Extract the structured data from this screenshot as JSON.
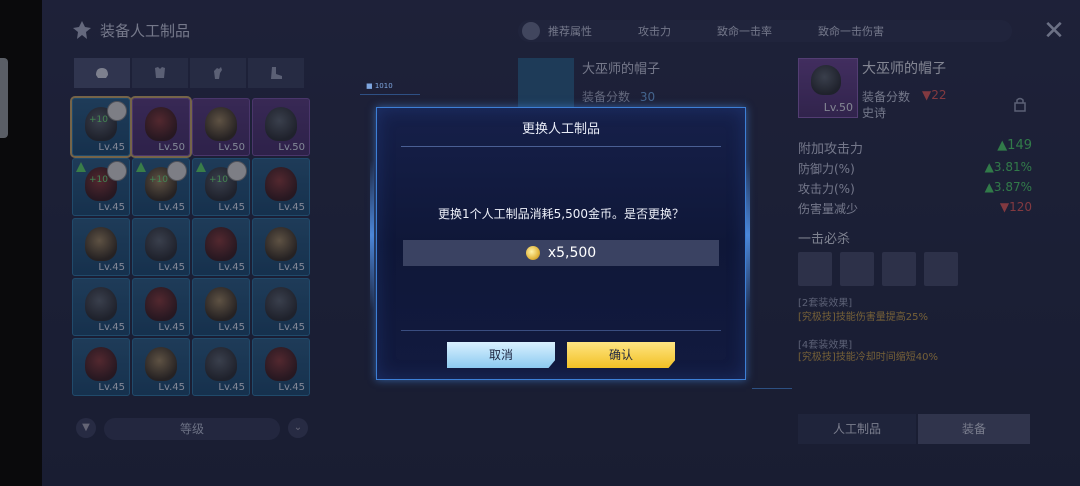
{
  "header": {
    "title": "装备人工制品"
  },
  "grid": {
    "items": [
      {
        "lv": "Lv.45",
        "plus": "+10",
        "variant": "blue",
        "selected": true,
        "avatar": true
      },
      {
        "lv": "Lv.50",
        "plus": "",
        "variant": "purple",
        "selected": true,
        "avatar": false
      },
      {
        "lv": "Lv.50",
        "plus": "",
        "variant": "purple"
      },
      {
        "lv": "Lv.50",
        "plus": "",
        "variant": "purple"
      },
      {
        "lv": "Lv.45",
        "plus": "+10",
        "variant": "blue",
        "arrow": true,
        "avatar": true
      },
      {
        "lv": "Lv.45",
        "plus": "+10",
        "variant": "blue",
        "arrow": true,
        "avatar": true
      },
      {
        "lv": "Lv.45",
        "plus": "+10",
        "variant": "blue",
        "arrow": true,
        "avatar": true
      },
      {
        "lv": "Lv.45",
        "plus": "",
        "variant": "blue"
      },
      {
        "lv": "Lv.45",
        "plus": "",
        "variant": "blue"
      },
      {
        "lv": "Lv.45",
        "plus": "",
        "variant": "blue"
      },
      {
        "lv": "Lv.45",
        "plus": "",
        "variant": "blue"
      },
      {
        "lv": "Lv.45",
        "plus": "",
        "variant": "blue"
      },
      {
        "lv": "Lv.45",
        "plus": "",
        "variant": "blue"
      },
      {
        "lv": "Lv.45",
        "plus": "",
        "variant": "blue"
      },
      {
        "lv": "Lv.45",
        "plus": "",
        "variant": "blue"
      },
      {
        "lv": "Lv.45",
        "plus": "",
        "variant": "blue"
      },
      {
        "lv": "Lv.45",
        "plus": "",
        "variant": "blue"
      },
      {
        "lv": "Lv.45",
        "plus": "",
        "variant": "blue"
      },
      {
        "lv": "Lv.45",
        "plus": "",
        "variant": "blue"
      },
      {
        "lv": "Lv.45",
        "plus": "",
        "variant": "blue"
      }
    ]
  },
  "sort": {
    "label": "等级"
  },
  "rec_bar": {
    "label": "推荐属性",
    "items": [
      "攻击力",
      "致命一击率",
      "致命一击伤害"
    ]
  },
  "middle": {
    "title": "大巫师的帽子",
    "score_label": "装备分数",
    "score": "30"
  },
  "right": {
    "title": "大巫师的帽子",
    "lv": "Lv.50",
    "score_label": "装备分数",
    "score_delta": "▼22",
    "rarity": "史诗",
    "stats": [
      {
        "name": "附加攻击力",
        "value": "▲149",
        "dir": "up"
      },
      {
        "name": "防御力(%)",
        "value": "▲3.81%",
        "dir": "up"
      },
      {
        "name": "攻击力(%)",
        "value": "▲3.87%",
        "dir": "up"
      },
      {
        "name": "伤害量减少",
        "value": "▼120",
        "dir": "down"
      }
    ],
    "skill_title": "一击必杀",
    "set2_title": "[2套装效果]",
    "set2_tag": "[究极技]",
    "set2_desc": "技能伤害量提高25%",
    "set4_title": "[4套装效果]",
    "set4_tag": "[究极技]",
    "set4_desc": "技能冷却时间缩短40%",
    "tab_artifact": "人工制品",
    "tab_equip": "装备"
  },
  "dialog": {
    "title": "更换人工制品",
    "message": "更换1个人工制品消耗5,500金币。是否更换？",
    "cost": "x5,500",
    "cancel": "取消",
    "confirm": "确认"
  },
  "deco_tag": "■ 1010"
}
